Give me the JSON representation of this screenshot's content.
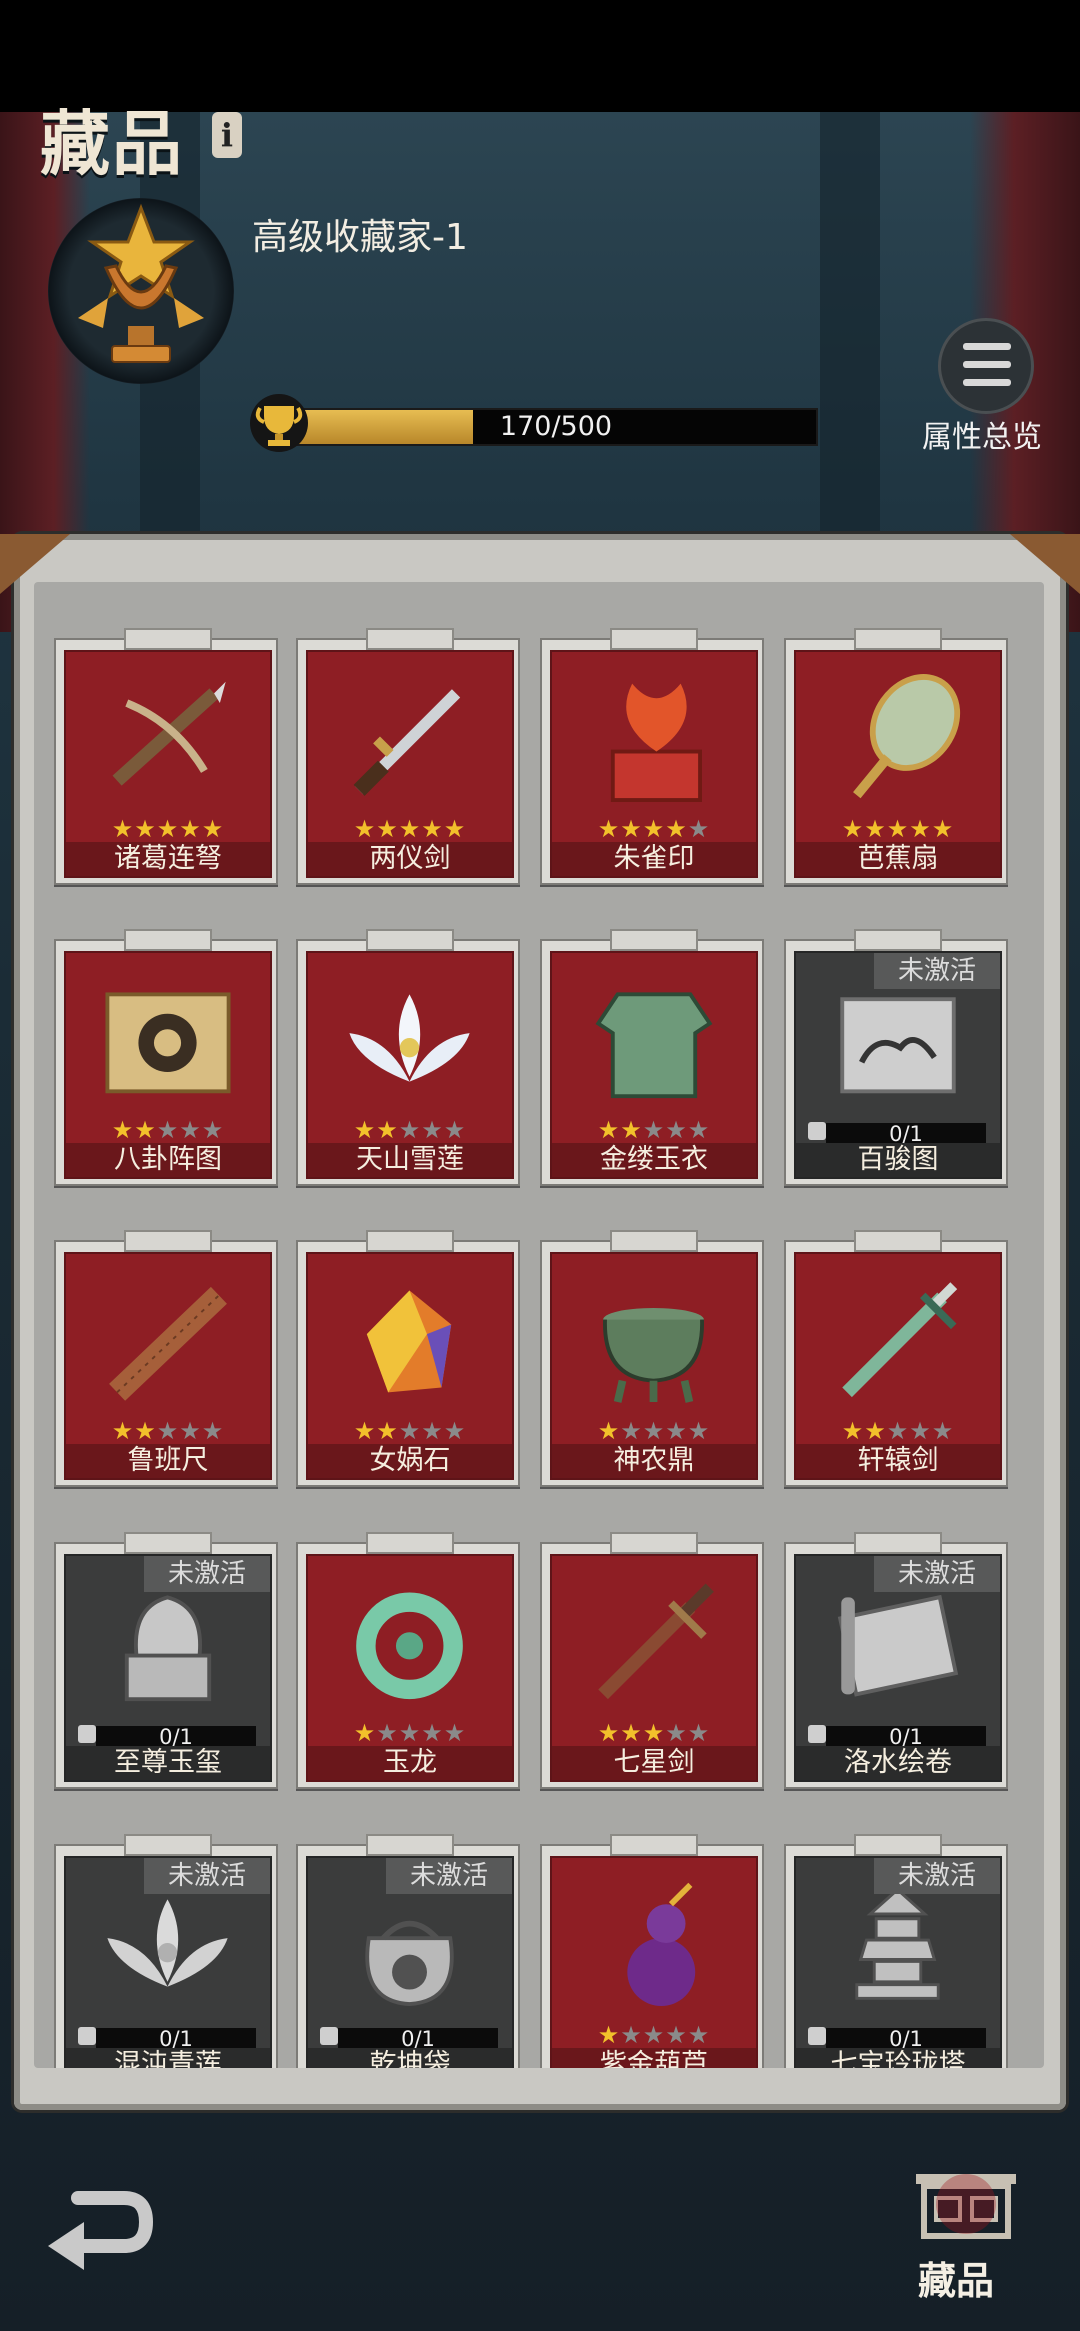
{
  "header": {
    "title": "藏品",
    "info_icon": "i",
    "rank_title": "高级收藏家-1",
    "progress": {
      "current": 170,
      "max": 500,
      "text": "170/500",
      "fraction": 0.34
    },
    "attr_label": "属性总览"
  },
  "colors": {
    "card_active": "#8e1e24",
    "card_locked": "#3b3c3c",
    "star_on": "#f2c12b",
    "star_off": "#8a8a8a",
    "bar_fill": "#d9a63d"
  },
  "locked_label": "未激活",
  "items": [
    {
      "name": "诸葛连弩",
      "stars": 5,
      "locked": false,
      "icon": "crossbow-icon"
    },
    {
      "name": "两仪剑",
      "stars": 5,
      "locked": false,
      "icon": "sword-icon"
    },
    {
      "name": "朱雀印",
      "stars": 4,
      "locked": false,
      "icon": "phoenix-seal-icon"
    },
    {
      "name": "芭蕉扇",
      "stars": 5,
      "locked": false,
      "icon": "fan-icon"
    },
    {
      "name": "八卦阵图",
      "stars": 2,
      "locked": false,
      "icon": "bagua-scroll-icon"
    },
    {
      "name": "天山雪莲",
      "stars": 2,
      "locked": false,
      "icon": "lotus-icon"
    },
    {
      "name": "金缕玉衣",
      "stars": 2,
      "locked": false,
      "icon": "jade-armor-icon"
    },
    {
      "name": "百骏图",
      "stars": 0,
      "locked": true,
      "progress": "0/1",
      "icon": "horse-painting-icon"
    },
    {
      "name": "鲁班尺",
      "stars": 2,
      "locked": false,
      "icon": "ruler-icon"
    },
    {
      "name": "女娲石",
      "stars": 2,
      "locked": false,
      "icon": "gem-stone-icon"
    },
    {
      "name": "神农鼎",
      "stars": 1,
      "locked": false,
      "icon": "cauldron-icon"
    },
    {
      "name": "轩辕剑",
      "stars": 2,
      "locked": false,
      "icon": "jade-sword-icon"
    },
    {
      "name": "至尊玉玺",
      "stars": 0,
      "locked": true,
      "progress": "0/1",
      "icon": "imperial-seal-icon"
    },
    {
      "name": "玉龙",
      "stars": 1,
      "locked": false,
      "icon": "jade-dragon-icon"
    },
    {
      "name": "七星剑",
      "stars": 3,
      "locked": false,
      "icon": "bronze-sword-icon"
    },
    {
      "name": "洛水绘卷",
      "stars": 0,
      "locked": true,
      "progress": "0/1",
      "icon": "scroll-icon"
    },
    {
      "name": "混沌青莲",
      "stars": 0,
      "locked": true,
      "progress": "0/1",
      "icon": "lotus-icon"
    },
    {
      "name": "乾坤袋",
      "stars": 0,
      "locked": true,
      "progress": "0/1",
      "icon": "bag-icon"
    },
    {
      "name": "紫金葫芦",
      "stars": 1,
      "locked": false,
      "icon": "gourd-icon"
    },
    {
      "name": "七宝玲珑塔",
      "stars": 0,
      "locked": true,
      "progress": "0/1",
      "icon": "pagoda-icon"
    }
  ],
  "nav": {
    "collection_label": "藏品"
  }
}
